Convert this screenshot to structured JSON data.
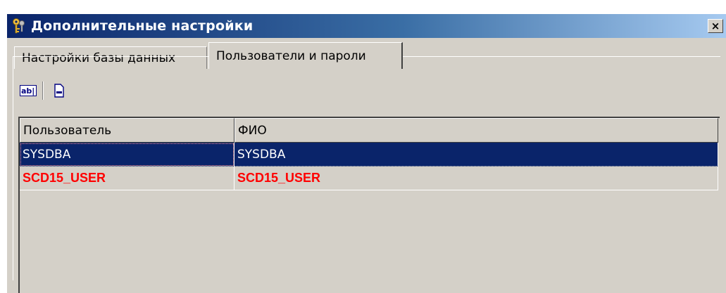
{
  "window": {
    "title": "Дополнительные настройки",
    "close_glyph": "×",
    "icon": "keys-icon"
  },
  "tabs": [
    {
      "label": "Настройки базы данных",
      "active": false
    },
    {
      "label": "Пользователи и пароли",
      "active": true
    }
  ],
  "toolbar": {
    "buttons": [
      {
        "name": "edit-user-button",
        "icon": "ab-edit-icon",
        "text": "ab|"
      },
      {
        "name": "remove-user-button",
        "icon": "minus-document-icon"
      }
    ]
  },
  "grid": {
    "columns": [
      "Пользователь",
      "ФИО"
    ],
    "rows": [
      {
        "user": "SYSDBA",
        "fio": "SYSDBA",
        "selected": true,
        "style": "normal"
      },
      {
        "user": "SCD15_USER",
        "fio": "SCD15_USER",
        "selected": false,
        "style": "red-bold"
      }
    ]
  },
  "colors": {
    "title_start": "#0a246a",
    "title_end": "#a6caf0",
    "selection": "#0a246a",
    "highlight_text": "#ff0000",
    "face": "#d4d0c8"
  }
}
